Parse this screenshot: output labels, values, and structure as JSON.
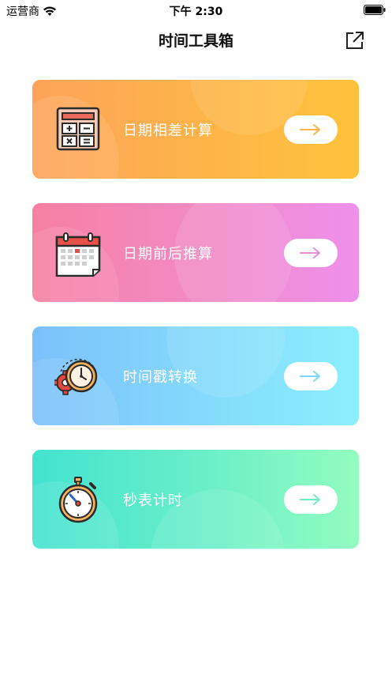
{
  "status_bar": {
    "carrier": "运营商",
    "time": "下午 2:30"
  },
  "nav": {
    "title": "时间工具箱",
    "share_icon": "share-external-icon"
  },
  "tools": [
    {
      "label": "日期相差计算",
      "icon": "calculator-icon",
      "arrow_color": "#fdb548"
    },
    {
      "label": "日期前后推算",
      "icon": "calendar-icon",
      "arrow_color": "#e88fd8"
    },
    {
      "label": "时间戳转换",
      "icon": "clock-gear-icon",
      "arrow_color": "#7fd7f6"
    },
    {
      "label": "秒表计时",
      "icon": "stopwatch-icon",
      "arrow_color": "#6fe9c6"
    }
  ]
}
